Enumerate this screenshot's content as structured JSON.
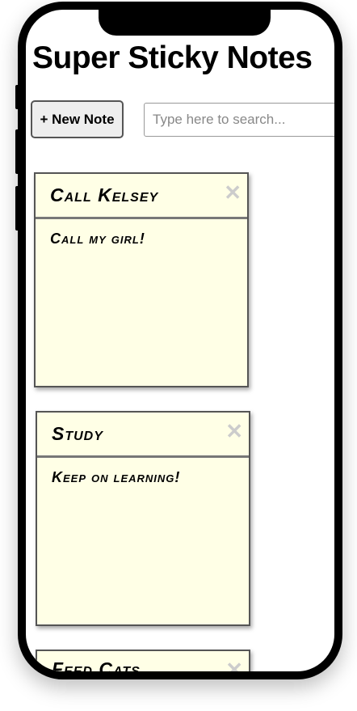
{
  "app": {
    "title": "Super Sticky Notes"
  },
  "toolbar": {
    "new_note_label": "+ New Note",
    "search_placeholder": "Type here to search...",
    "search_value": ""
  },
  "notes": [
    {
      "title": "Call Kelsey",
      "body": "Call my girl!",
      "close": "✕"
    },
    {
      "title": "Study",
      "body": "Keep on learning!",
      "close": "✕"
    },
    {
      "title": "Feed Cats",
      "body": "",
      "close": "✕"
    }
  ]
}
